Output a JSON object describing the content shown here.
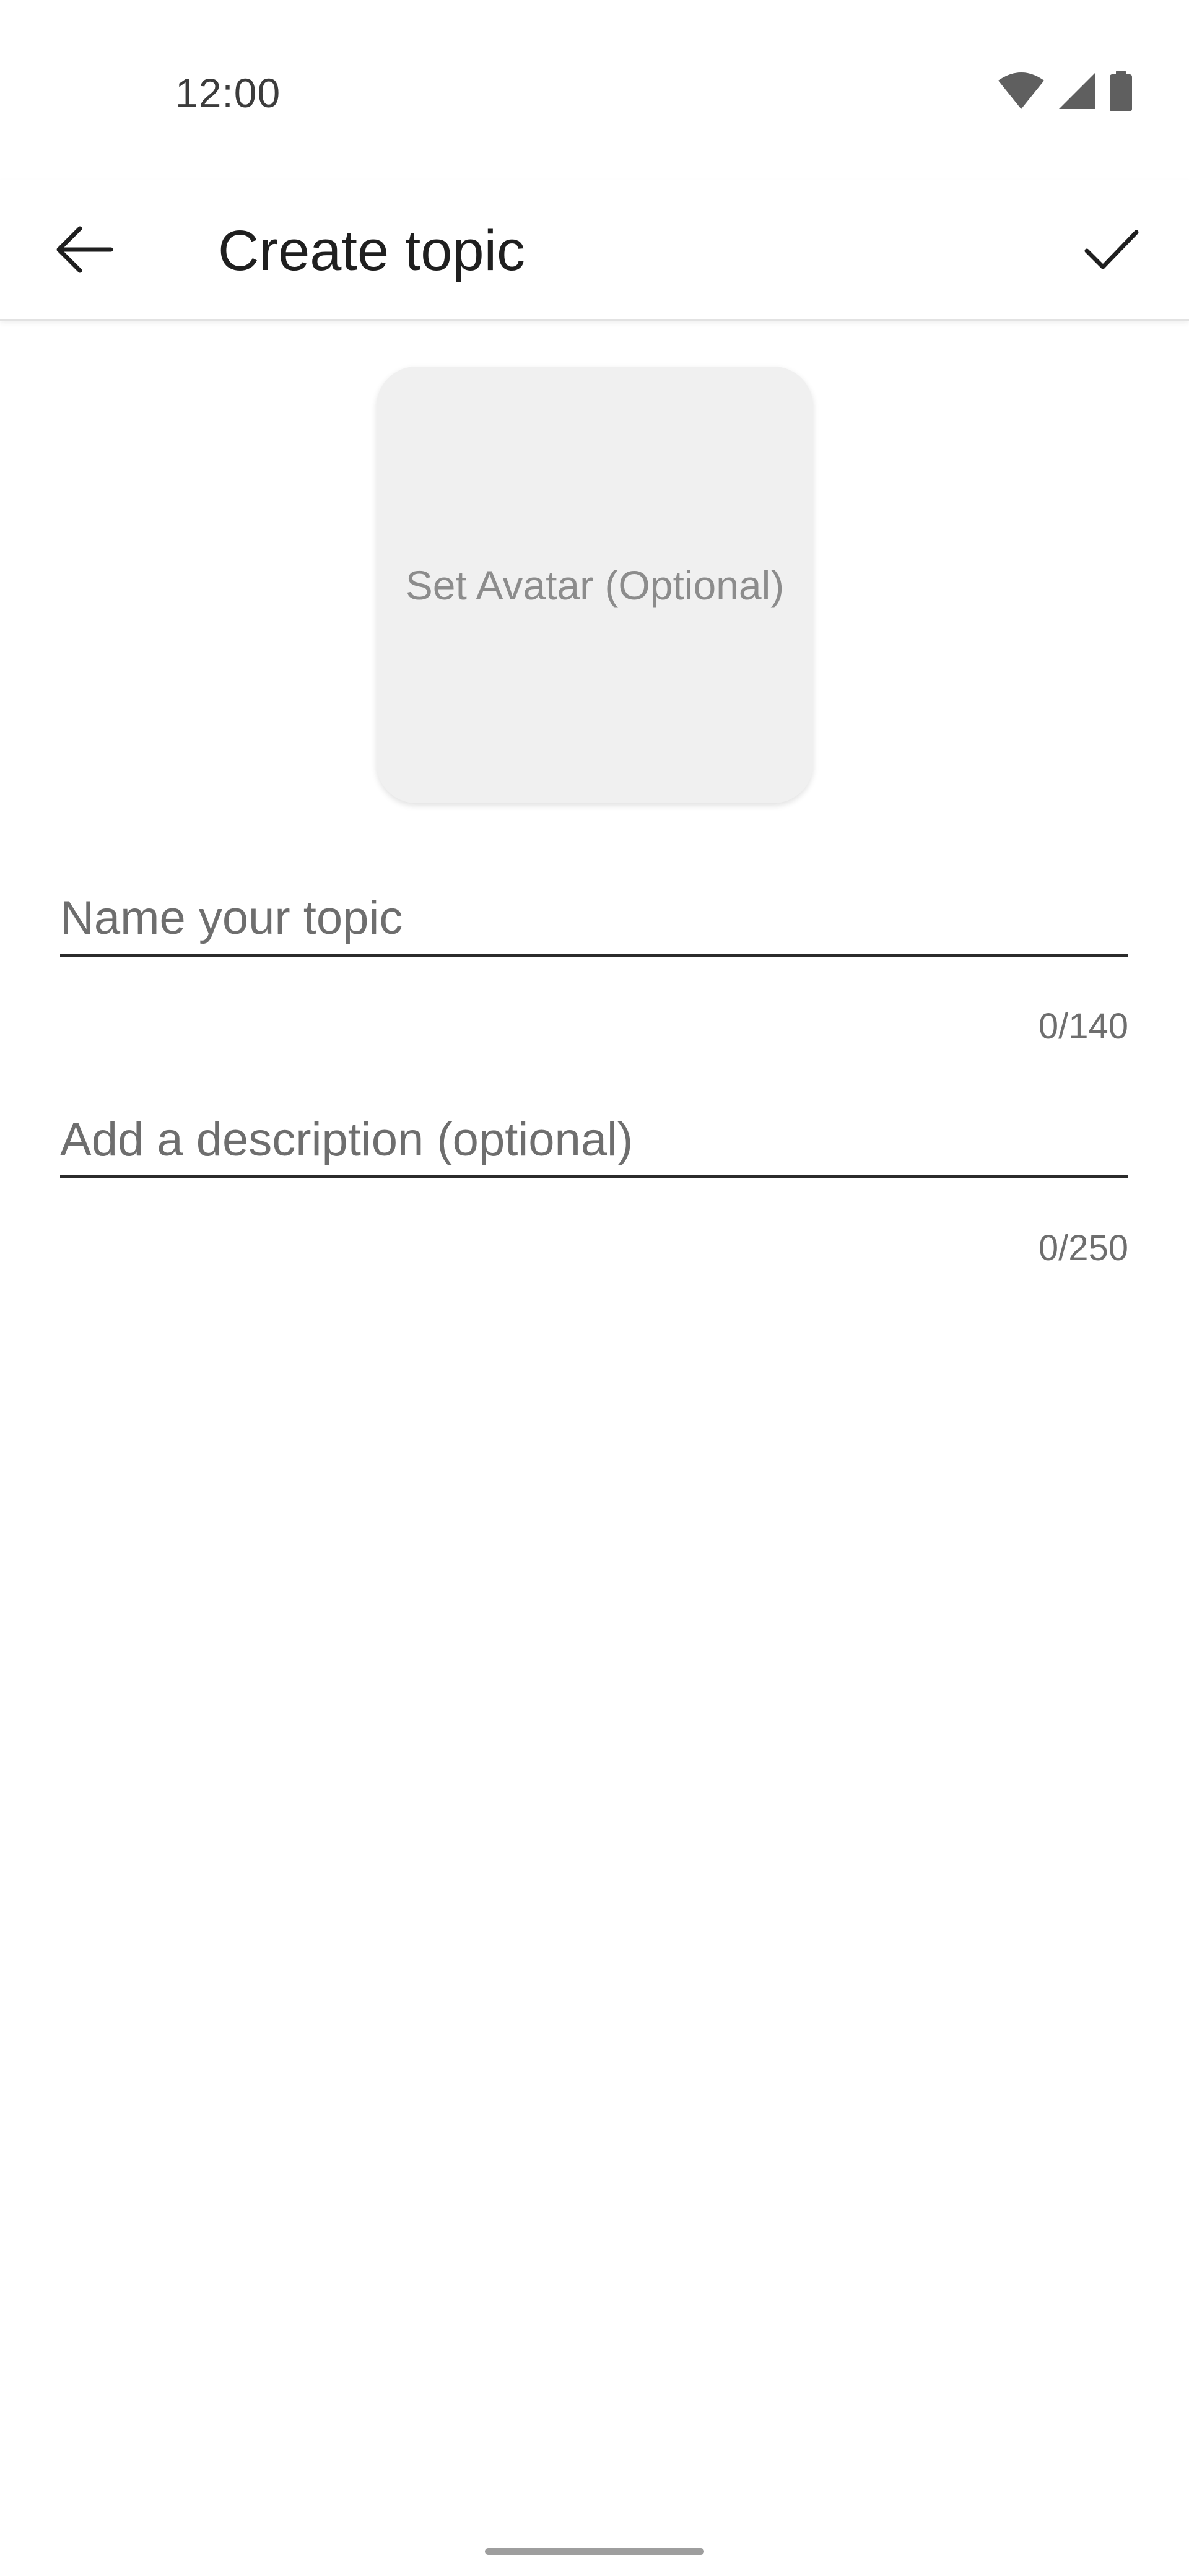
{
  "status_bar": {
    "time": "12:00",
    "icons": [
      "wifi-icon",
      "cellular-signal-icon",
      "battery-icon"
    ]
  },
  "app_bar": {
    "title": "Create topic",
    "back_icon": "arrow-back-icon",
    "confirm_icon": "check-icon"
  },
  "avatar": {
    "label": "Set Avatar (Optional)"
  },
  "name_field": {
    "value": "",
    "placeholder": "Name your topic",
    "counter": "0/140"
  },
  "description_field": {
    "value": "",
    "placeholder": "Add a description (optional)",
    "counter": "0/250"
  },
  "colors": {
    "background": "#ffffff",
    "avatar_background": "#f0f0f0",
    "text_primary": "#1f1f1f",
    "text_secondary": "#6e6e6e"
  }
}
